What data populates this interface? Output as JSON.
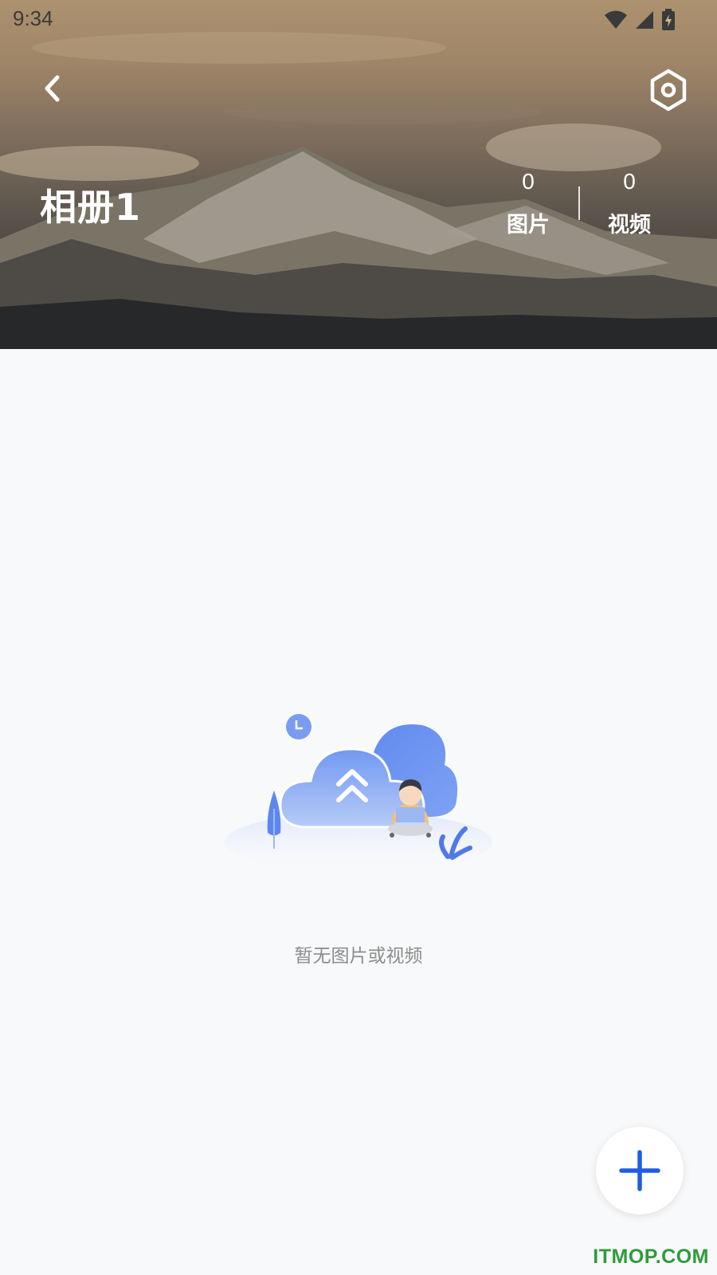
{
  "status_bar": {
    "time": "9:34",
    "icons": [
      "wifi-icon",
      "signal-icon",
      "battery-charging-icon"
    ]
  },
  "header": {
    "back_icon": "chevron-left-icon",
    "settings_icon": "hexagon-settings-icon",
    "album_title": "相册1",
    "stats": {
      "photos": {
        "count": "0",
        "label": "图片"
      },
      "videos": {
        "count": "0",
        "label": "视频"
      }
    }
  },
  "empty_state": {
    "illustration": "cloud-upload-person-illustration",
    "message": "暂无图片或视频"
  },
  "fab": {
    "icon": "plus-icon",
    "color": "#1f5ce6"
  },
  "watermark": "ITMOP.COM",
  "colors": {
    "background": "#f8f9fa",
    "accent": "#1f5ce6",
    "empty_text": "#8c8c8c",
    "watermark": "#2e9b3a"
  }
}
